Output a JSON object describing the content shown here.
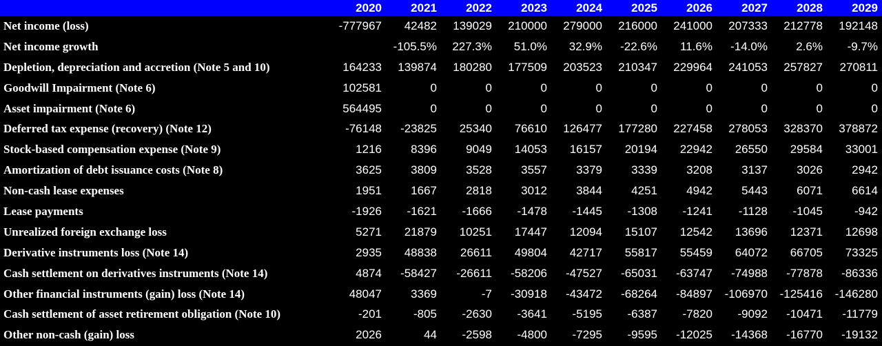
{
  "header": {
    "years": [
      "2020",
      "2021",
      "2022",
      "2023",
      "2024",
      "2025",
      "2026",
      "2027",
      "2028",
      "2029"
    ]
  },
  "rows": [
    {
      "label": "Net income (loss)",
      "values": [
        "-777967",
        "42482",
        "139029",
        "210000",
        "279000",
        "216000",
        "241000",
        "207333",
        "212778",
        "192148"
      ]
    },
    {
      "label": "Net income growth",
      "values": [
        "",
        "-105.5%",
        "227.3%",
        "51.0%",
        "32.9%",
        "-22.6%",
        "11.6%",
        "-14.0%",
        "2.6%",
        "-9.7%"
      ]
    },
    {
      "label": "Depletion, depreciation and accretion (Note 5 and 10)",
      "values": [
        "164233",
        "139874",
        "180280",
        "177509",
        "203523",
        "210347",
        "229964",
        "241053",
        "257827",
        "270811"
      ]
    },
    {
      "label": "Goodwill Impairment (Note 6)",
      "values": [
        "102581",
        "0",
        "0",
        "0",
        "0",
        "0",
        "0",
        "0",
        "0",
        "0"
      ]
    },
    {
      "label": "Asset impairment (Note 6)",
      "values": [
        "564495",
        "0",
        "0",
        "0",
        "0",
        "0",
        "0",
        "0",
        "0",
        "0"
      ]
    },
    {
      "label": "Deferred tax expense (recovery) (Note 12)",
      "values": [
        "-76148",
        "-23825",
        "25340",
        "76610",
        "126477",
        "177280",
        "227458",
        "278053",
        "328370",
        "378872"
      ]
    },
    {
      "label": "Stock-based compensation expense (Note 9)",
      "values": [
        "1216",
        "8396",
        "9049",
        "14053",
        "16157",
        "20194",
        "22942",
        "26550",
        "29584",
        "33001"
      ]
    },
    {
      "label": "Amortization of debt issuance costs (Note 8)",
      "values": [
        "3625",
        "3809",
        "3528",
        "3557",
        "3379",
        "3339",
        "3208",
        "3137",
        "3026",
        "2942"
      ]
    },
    {
      "label": "Non-cash lease expenses",
      "values": [
        "1951",
        "1667",
        "2818",
        "3012",
        "3844",
        "4251",
        "4942",
        "5443",
        "6071",
        "6614"
      ]
    },
    {
      "label": "Lease payments",
      "values": [
        "-1926",
        "-1621",
        "-1666",
        "-1478",
        "-1445",
        "-1308",
        "-1241",
        "-1128",
        "-1045",
        "-942"
      ]
    },
    {
      "label": "Unrealized foreign exchange loss",
      "values": [
        "5271",
        "21879",
        "10251",
        "17447",
        "12094",
        "15107",
        "12542",
        "13696",
        "12371",
        "12698"
      ]
    },
    {
      "label": "Derivative instruments loss (Note 14)",
      "values": [
        "2935",
        "48838",
        "26611",
        "49804",
        "42717",
        "55817",
        "55459",
        "64072",
        "66705",
        "73325"
      ]
    },
    {
      "label": "Cash settlement on derivatives instruments (Note 14)",
      "values": [
        "4874",
        "-58427",
        "-26611",
        "-58206",
        "-47527",
        "-65031",
        "-63747",
        "-74988",
        "-77878",
        "-86336"
      ]
    },
    {
      "label": "Other financial instruments (gain) loss (Note 14)",
      "values": [
        "48047",
        "3369",
        "-7",
        "-30918",
        "-43472",
        "-68264",
        "-84897",
        "-106970",
        "-125416",
        "-146280"
      ]
    },
    {
      "label": "Cash settlement of asset retirement obligation (Note 10)",
      "values": [
        "-201",
        "-805",
        "-2630",
        "-3641",
        "-5195",
        "-6387",
        "-7820",
        "-9092",
        "-10471",
        "-11779"
      ]
    },
    {
      "label": "Other non-cash (gain) loss",
      "values": [
        "2026",
        "44",
        "-2598",
        "-4800",
        "-7295",
        "-9595",
        "-12025",
        "-14368",
        "-16770",
        "-19132"
      ]
    }
  ],
  "colors": {
    "header_bg": "#0000FF",
    "body_bg": "#000000",
    "text": "#FFFFFF"
  }
}
